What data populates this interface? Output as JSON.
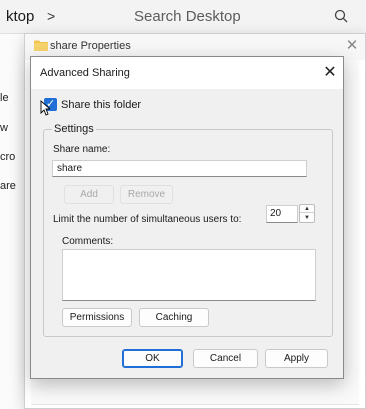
{
  "explorer": {
    "breadcrumb": "ktop",
    "chevron": ">",
    "search_placeholder": "Search Desktop",
    "left_items": [
      "le",
      "w",
      "cro",
      "are"
    ]
  },
  "properties": {
    "title": "share Properties",
    "close": "✕"
  },
  "dialog": {
    "title": "Advanced Sharing",
    "close": "✕",
    "share_checkbox": {
      "label": "Share this folder",
      "checked": true
    },
    "settings_group": "Settings",
    "share_name_label": "Share name:",
    "share_name_value": "share",
    "add_button": "Add",
    "remove_button": "Remove",
    "limit_label": "Limit the number of simultaneous users to:",
    "limit_value": "20",
    "comments_label": "Comments:",
    "comments_value": "",
    "permissions_button": "Permissions",
    "caching_button": "Caching",
    "ok_button": "OK",
    "cancel_button": "Cancel",
    "apply_button": "Apply"
  },
  "colors": {
    "accent": "#1f6fd6",
    "folder": "#f2c44e"
  }
}
